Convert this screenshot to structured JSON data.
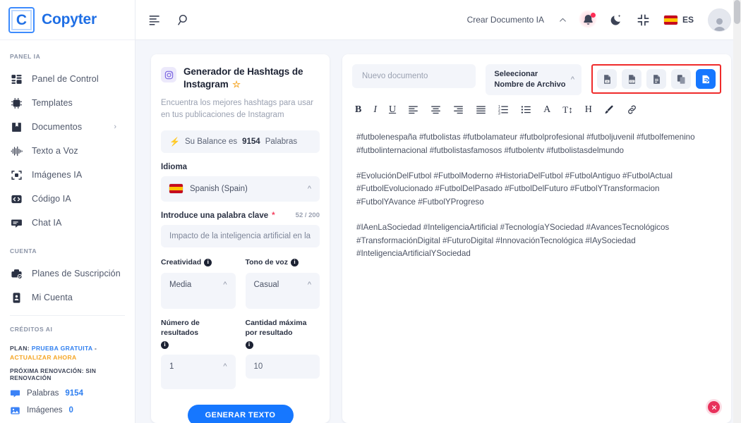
{
  "brand": {
    "logo_letter": "C",
    "name": "Copyter"
  },
  "sidebar": {
    "section_panel_title": "PANEL IA",
    "items": [
      {
        "label": "Panel de Control",
        "icon": "dashboard-icon"
      },
      {
        "label": "Templates",
        "icon": "chip-ai-icon"
      },
      {
        "label": "Documentos",
        "icon": "book-icon",
        "caret": "›"
      },
      {
        "label": "Texto a Voz",
        "icon": "waveform-icon"
      },
      {
        "label": "Imágenes IA",
        "icon": "image-frame-icon"
      },
      {
        "label": "Código IA",
        "icon": "code-icon"
      },
      {
        "label": "Chat IA",
        "icon": "chat-icon"
      }
    ],
    "section_account_title": "CUENTA",
    "account_items": [
      {
        "label": "Planes de Suscripción",
        "icon": "briefcase-check-icon"
      },
      {
        "label": "Mi Cuenta",
        "icon": "id-card-icon"
      }
    ],
    "section_credits_title": "CRÉDITOS AI",
    "plan_prefix": "PLAN:",
    "plan_name": "PRUEBA GRATUITA",
    "plan_sep": "-",
    "plan_upgrade": "ACTUALIZAR AHORA",
    "renewal": "PRÓXIMA RENOVACIÓN: SIN RENOVACIÓN",
    "stats": [
      {
        "label": "Palabras",
        "value": "9154",
        "icon": "chat-bubble-icon"
      },
      {
        "label": "Imágenes",
        "value": "0",
        "icon": "picture-icon"
      }
    ]
  },
  "topbar": {
    "menu_icon": "menu-collapse-icon",
    "search_icon": "search-icon",
    "create_doc": "Crear Documento IA",
    "chevron": "⌃",
    "bell_icon": "bell-icon",
    "dark_mode_icon": "moon-icon",
    "fullscreen_icon": "collapse-screen-icon",
    "lang_code": "ES",
    "avatar_icon": "user-avatar"
  },
  "form": {
    "app_icon": "instagram-icon",
    "title": "Generador de Hashtags de Instagram",
    "favorite_icon": "star-icon",
    "description": "Encuentra los mejores hashtags para usar en tus publicaciones de Instagram",
    "balance_icon": "bolt-icon",
    "balance_prefix": "Su Balance es",
    "balance_value": "9154",
    "balance_suffix": "Palabras",
    "language_label": "Idioma",
    "language_value": "Spanish (Spain)",
    "keyword_label": "Introduce una palabra clave",
    "keyword_required": "*",
    "keyword_counter": "52 / 200",
    "keyword_value": "Impacto de la inteligencia artificial en la",
    "creativity_label": "Creatividad",
    "creativity_value": "Media",
    "tone_label": "Tono de voz",
    "tone_value": "Casual",
    "results_label": "Número de resultados",
    "results_value": "1",
    "max_label": "Cantidad máxima por resultado",
    "max_value": "10",
    "generate_button": "GENERAR TEXTO"
  },
  "editor": {
    "doc_name_placeholder": "Nuevo documento",
    "file_select_label": "Seleecionar Nombre de Archivo",
    "export_buttons": [
      {
        "name": "export-word-button",
        "icon": "word-doc-icon",
        "tag": "W"
      },
      {
        "name": "export-pdf-button",
        "icon": "pdf-doc-icon",
        "tag": "PDF"
      },
      {
        "name": "export-text-button",
        "icon": "text-doc-icon",
        "tag": ""
      },
      {
        "name": "copy-document-button",
        "icon": "copy-icon",
        "tag": ""
      },
      {
        "name": "save-document-button",
        "icon": "save-export-icon",
        "tag": ""
      }
    ],
    "toolbar": [
      {
        "name": "bold-button",
        "glyph": "B",
        "style": "font-weight:700;"
      },
      {
        "name": "italic-button",
        "glyph": "I",
        "style": "font-style:italic;font-family:'Liberation Serif',serif;"
      },
      {
        "name": "underline-button",
        "glyph": "U",
        "style": "text-decoration:underline;"
      },
      {
        "name": "align-left-button",
        "icon": "align-left-icon"
      },
      {
        "name": "align-center-button",
        "icon": "align-center-icon"
      },
      {
        "name": "align-right-button",
        "icon": "align-right-icon"
      },
      {
        "name": "align-justify-button",
        "icon": "align-justify-icon"
      },
      {
        "name": "ordered-list-button",
        "icon": "ordered-list-icon"
      },
      {
        "name": "bullet-list-button",
        "icon": "bullet-list-icon"
      },
      {
        "name": "font-color-button",
        "glyph": "A",
        "style": "font-family:'Liberation Serif',serif;"
      },
      {
        "name": "font-size-button",
        "glyph": "T↕",
        "style": "font-size:12px;"
      },
      {
        "name": "heading-button",
        "glyph": "H",
        "style": "font-family:'Liberation Serif',serif;"
      },
      {
        "name": "highlight-brush-button",
        "icon": "brush-icon"
      },
      {
        "name": "insert-link-button",
        "icon": "link-icon"
      }
    ],
    "paragraphs": [
      "#futbolenespaña #futbolistas #futbolamateur #futbolprofesional #futboljuvenil #futbolfemenino #futbolinternacional #futbolistasfamosos #futbolentv #futbolistasdelmundo",
      "#EvoluciónDelFutbol #FutbolModerno #HistoriaDelFutbol #FutbolAntiguo #FutbolActual #FutbolEvolucionado #FutbolDelPasado #FutbolDelFuturo #FutbolYTransformacion #FutbolYAvance #FutbolYProgreso",
      "#IAenLaSociedad #InteligenciaArtificial #TecnologíaYSociedad #AvancesTecnológicos #TransformaciónDigital #FuturoDigital #InnovaciónTecnológica #IAySociedad #InteligenciaArtificialYSociedad"
    ],
    "close_icon": "close-circle-icon"
  },
  "colors": {
    "brand_blue": "#1f6fe5",
    "primary_blue": "#1677ff",
    "accent_orange": "#f5a524",
    "highlight_red": "#ef2b2b",
    "close_red": "#e8315b",
    "bg": "#f4f6fb"
  }
}
